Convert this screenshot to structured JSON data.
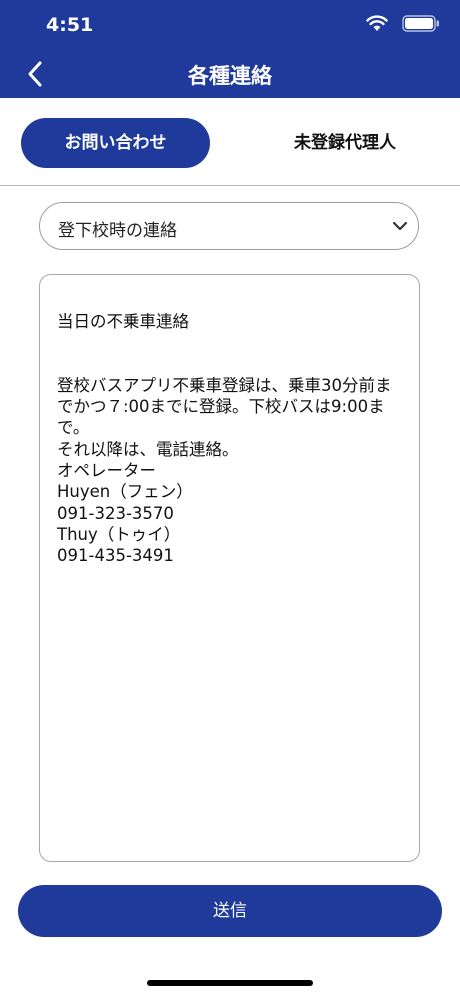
{
  "status_bar": {
    "time": "4:51"
  },
  "header": {
    "title": "各種連絡",
    "back_icon": "chevron-left-icon"
  },
  "tabs": [
    {
      "label": "お問い合わせ",
      "active": true
    },
    {
      "label": "未登録代理人",
      "active": false
    }
  ],
  "contact_type": {
    "selected": "登下校時の連絡",
    "icon": "chevron-down-icon"
  },
  "message": {
    "text": "当日の不乗車連絡\n\n\n登校バスアプリ不乗車登録は、乗車30分前までかつ７:00までに登録。下校バスは9:00まで。\nそれ以降は、電話連絡。\nオペレーター\nHuyen（フェン）\n091-323-3570\nThuy（トゥイ）\n091-435-3491"
  },
  "send_button": {
    "label": "送信"
  },
  "colors": {
    "brand": "#1f3a9a",
    "background": "#ffffff",
    "border": "#a8a8a8"
  }
}
